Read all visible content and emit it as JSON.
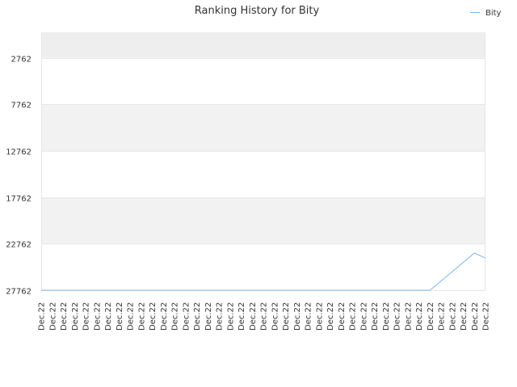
{
  "chart_data": {
    "type": "line",
    "title": "Ranking History for Bity",
    "xlabel": "",
    "ylabel": "",
    "x": [
      "Dec.22",
      "Dec.22",
      "Dec.22",
      "Dec.22",
      "Dec.22",
      "Dec.22",
      "Dec.22",
      "Dec.22",
      "Dec.22",
      "Dec.22",
      "Dec.22",
      "Dec.22",
      "Dec.22",
      "Dec.22",
      "Dec.22",
      "Dec.22",
      "Dec.22",
      "Dec.22",
      "Dec.22",
      "Dec.22",
      "Dec.22",
      "Dec.22",
      "Dec.22",
      "Dec.22",
      "Dec.22",
      "Dec.22",
      "Dec.22",
      "Dec.22",
      "Dec.22",
      "Dec.22",
      "Dec.22",
      "Dec.22",
      "Dec.22",
      "Dec.22",
      "Dec.22",
      "Dec.22",
      "Dec.22",
      "Dec.22",
      "Dec.22",
      "Dec.22",
      "Dec.22"
    ],
    "series": [
      {
        "name": "Bity",
        "color": "#7cb5ec",
        "values": [
          27762,
          27762,
          27762,
          27762,
          27762,
          27762,
          27762,
          27762,
          27762,
          27762,
          27762,
          27762,
          27762,
          27762,
          27762,
          27762,
          27762,
          27762,
          27762,
          27762,
          27762,
          27762,
          27762,
          27762,
          27762,
          27762,
          27762,
          27762,
          27762,
          27762,
          27762,
          27762,
          27762,
          27762,
          27762,
          27762,
          26762,
          25762,
          24762,
          23762,
          24300
        ]
      }
    ],
    "yaxis": {
      "reversed": true,
      "range": [
        0,
        27762
      ],
      "ticks": [
        2762,
        7762,
        12762,
        17762,
        22762,
        27762
      ],
      "tick_labels": [
        "2762",
        "7762",
        "12762",
        "17762",
        "22762",
        "27762"
      ]
    },
    "grid": true,
    "band_colors": [
      "#eeeeee",
      "#ffffff",
      "#f2f2f2",
      "#ffffff",
      "#f2f2f2",
      "#ffffff"
    ],
    "legend": {
      "position": "top-right",
      "label": "Bity"
    }
  }
}
